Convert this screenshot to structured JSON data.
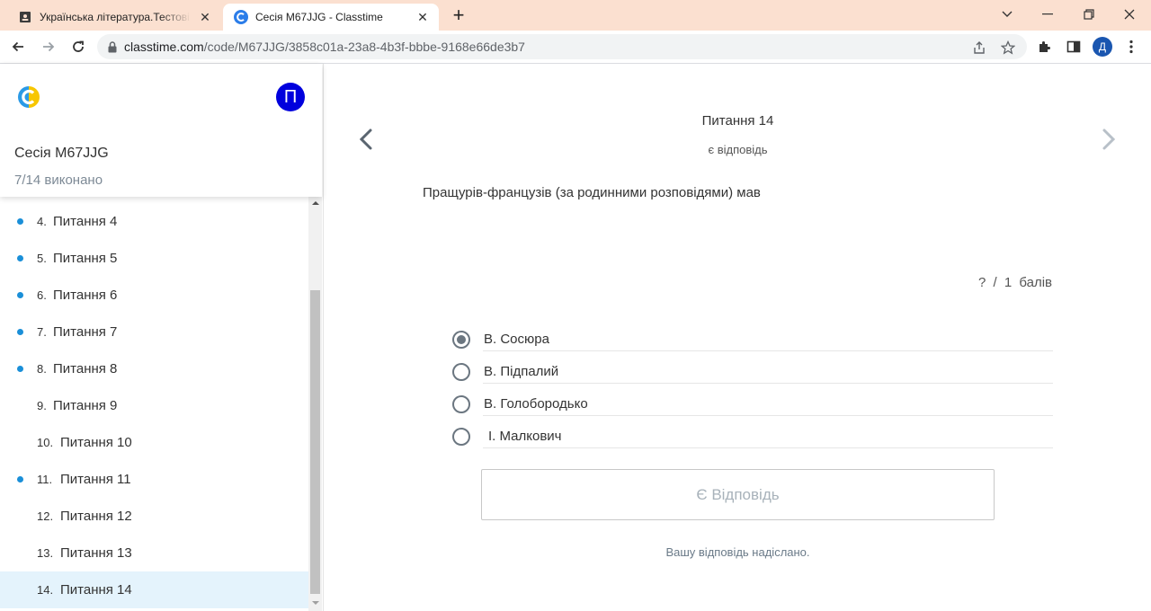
{
  "browser": {
    "tabs": [
      {
        "title": "Українська література.Тестові за",
        "active": false,
        "close": "✕"
      },
      {
        "title": "Сесія M67JJG - Classtime",
        "active": true,
        "close": "✕"
      }
    ],
    "new_tab": "+",
    "window_controls": {
      "minimize": "—",
      "restore": "❐",
      "close": "✕"
    },
    "url_domain": "classtime.com",
    "url_path": "/code/M67JJG/3858c01a-23a8-4b3f-bbbe-9168e66de3b7",
    "profile_initial": "Д"
  },
  "sidebar": {
    "user_initial": "П",
    "session_title": "Сесія M67JJG",
    "progress": "7/14 виконано",
    "items": [
      {
        "num": "4.",
        "label": "Питання 4",
        "answered": true,
        "current": false
      },
      {
        "num": "5.",
        "label": "Питання 5",
        "answered": true,
        "current": false
      },
      {
        "num": "6.",
        "label": "Питання 6",
        "answered": true,
        "current": false
      },
      {
        "num": "7.",
        "label": "Питання 7",
        "answered": true,
        "current": false
      },
      {
        "num": "8.",
        "label": "Питання 8",
        "answered": true,
        "current": false
      },
      {
        "num": "9.",
        "label": "Питання 9",
        "answered": false,
        "current": false
      },
      {
        "num": "10.",
        "label": "Питання 10",
        "answered": false,
        "current": false
      },
      {
        "num": "11.",
        "label": "Питання 11",
        "answered": true,
        "current": false
      },
      {
        "num": "12.",
        "label": "Питання 12",
        "answered": false,
        "current": false
      },
      {
        "num": "13.",
        "label": "Питання 13",
        "answered": false,
        "current": false
      },
      {
        "num": "14.",
        "label": "Питання 14",
        "answered": false,
        "current": true
      }
    ]
  },
  "main": {
    "heading": "Питання 14",
    "status": "є відповідь",
    "question": "Пращурів-французів (за родинними розповідями) мав",
    "points": "? / 1 балів",
    "options": [
      {
        "label": "В. Сосюра",
        "selected": true
      },
      {
        "label": "В. Підпалий",
        "selected": false
      },
      {
        "label": "В. Голобородько",
        "selected": false
      },
      {
        "label": "І. Малкович",
        "selected": false
      }
    ],
    "answer_button": "Є Відповідь",
    "submitted_note": "Вашу відповідь надіслано."
  },
  "colors": {
    "tabstrip": "#fbe0d0",
    "accent_dot": "#1a8fd8",
    "avatar": "#0000dd",
    "current_item": "#e4f3fc"
  }
}
